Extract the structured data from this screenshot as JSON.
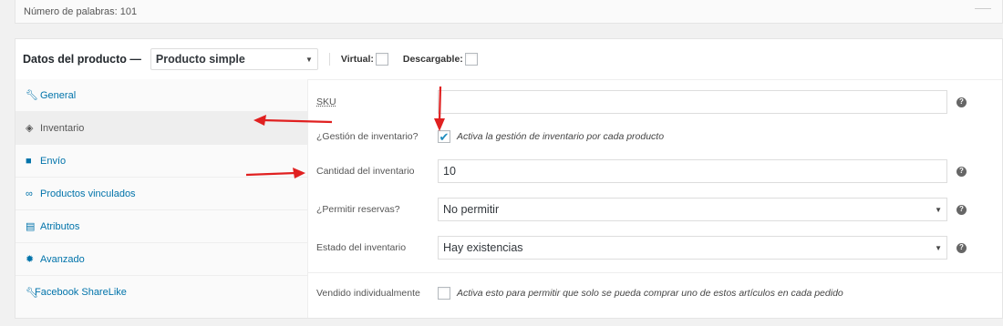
{
  "word_count": "Número de palabras: 101",
  "product_data": {
    "title": "Datos del producto —",
    "type_select": "Producto simple",
    "virtual_label": "Virtual:",
    "downloadable_label": "Descargable:"
  },
  "tabs": [
    {
      "label": "General",
      "icon": "wrench-icon"
    },
    {
      "label": "Inventario",
      "icon": "tag-icon"
    },
    {
      "label": "Envío",
      "icon": "truck-icon"
    },
    {
      "label": "Productos vinculados",
      "icon": "link-icon"
    },
    {
      "label": "Atributos",
      "icon": "list-icon"
    },
    {
      "label": "Avanzado",
      "icon": "gear-icon"
    },
    {
      "label": "Facebook ShareLike",
      "icon": "wrench-icon"
    }
  ],
  "fields": {
    "sku": {
      "label": "SKU",
      "value": ""
    },
    "manage_stock": {
      "label": "¿Gestión de inventario?",
      "description": "Activa la gestión de inventario por cada producto",
      "checked": true
    },
    "stock_qty": {
      "label": "Cantidad del inventario",
      "value": "10"
    },
    "backorders": {
      "label": "¿Permitir reservas?",
      "value": "No permitir"
    },
    "stock_status": {
      "label": "Estado del inventario",
      "value": "Hay existencias"
    },
    "sold_individually": {
      "label": "Vendido individualmente",
      "description": "Activa esto para permitir que solo se pueda comprar uno de estos artículos en cada pedido",
      "checked": false
    }
  },
  "colors": {
    "link": "#0073aa",
    "arrow": "#e02020",
    "check": "#1e8cbe"
  }
}
